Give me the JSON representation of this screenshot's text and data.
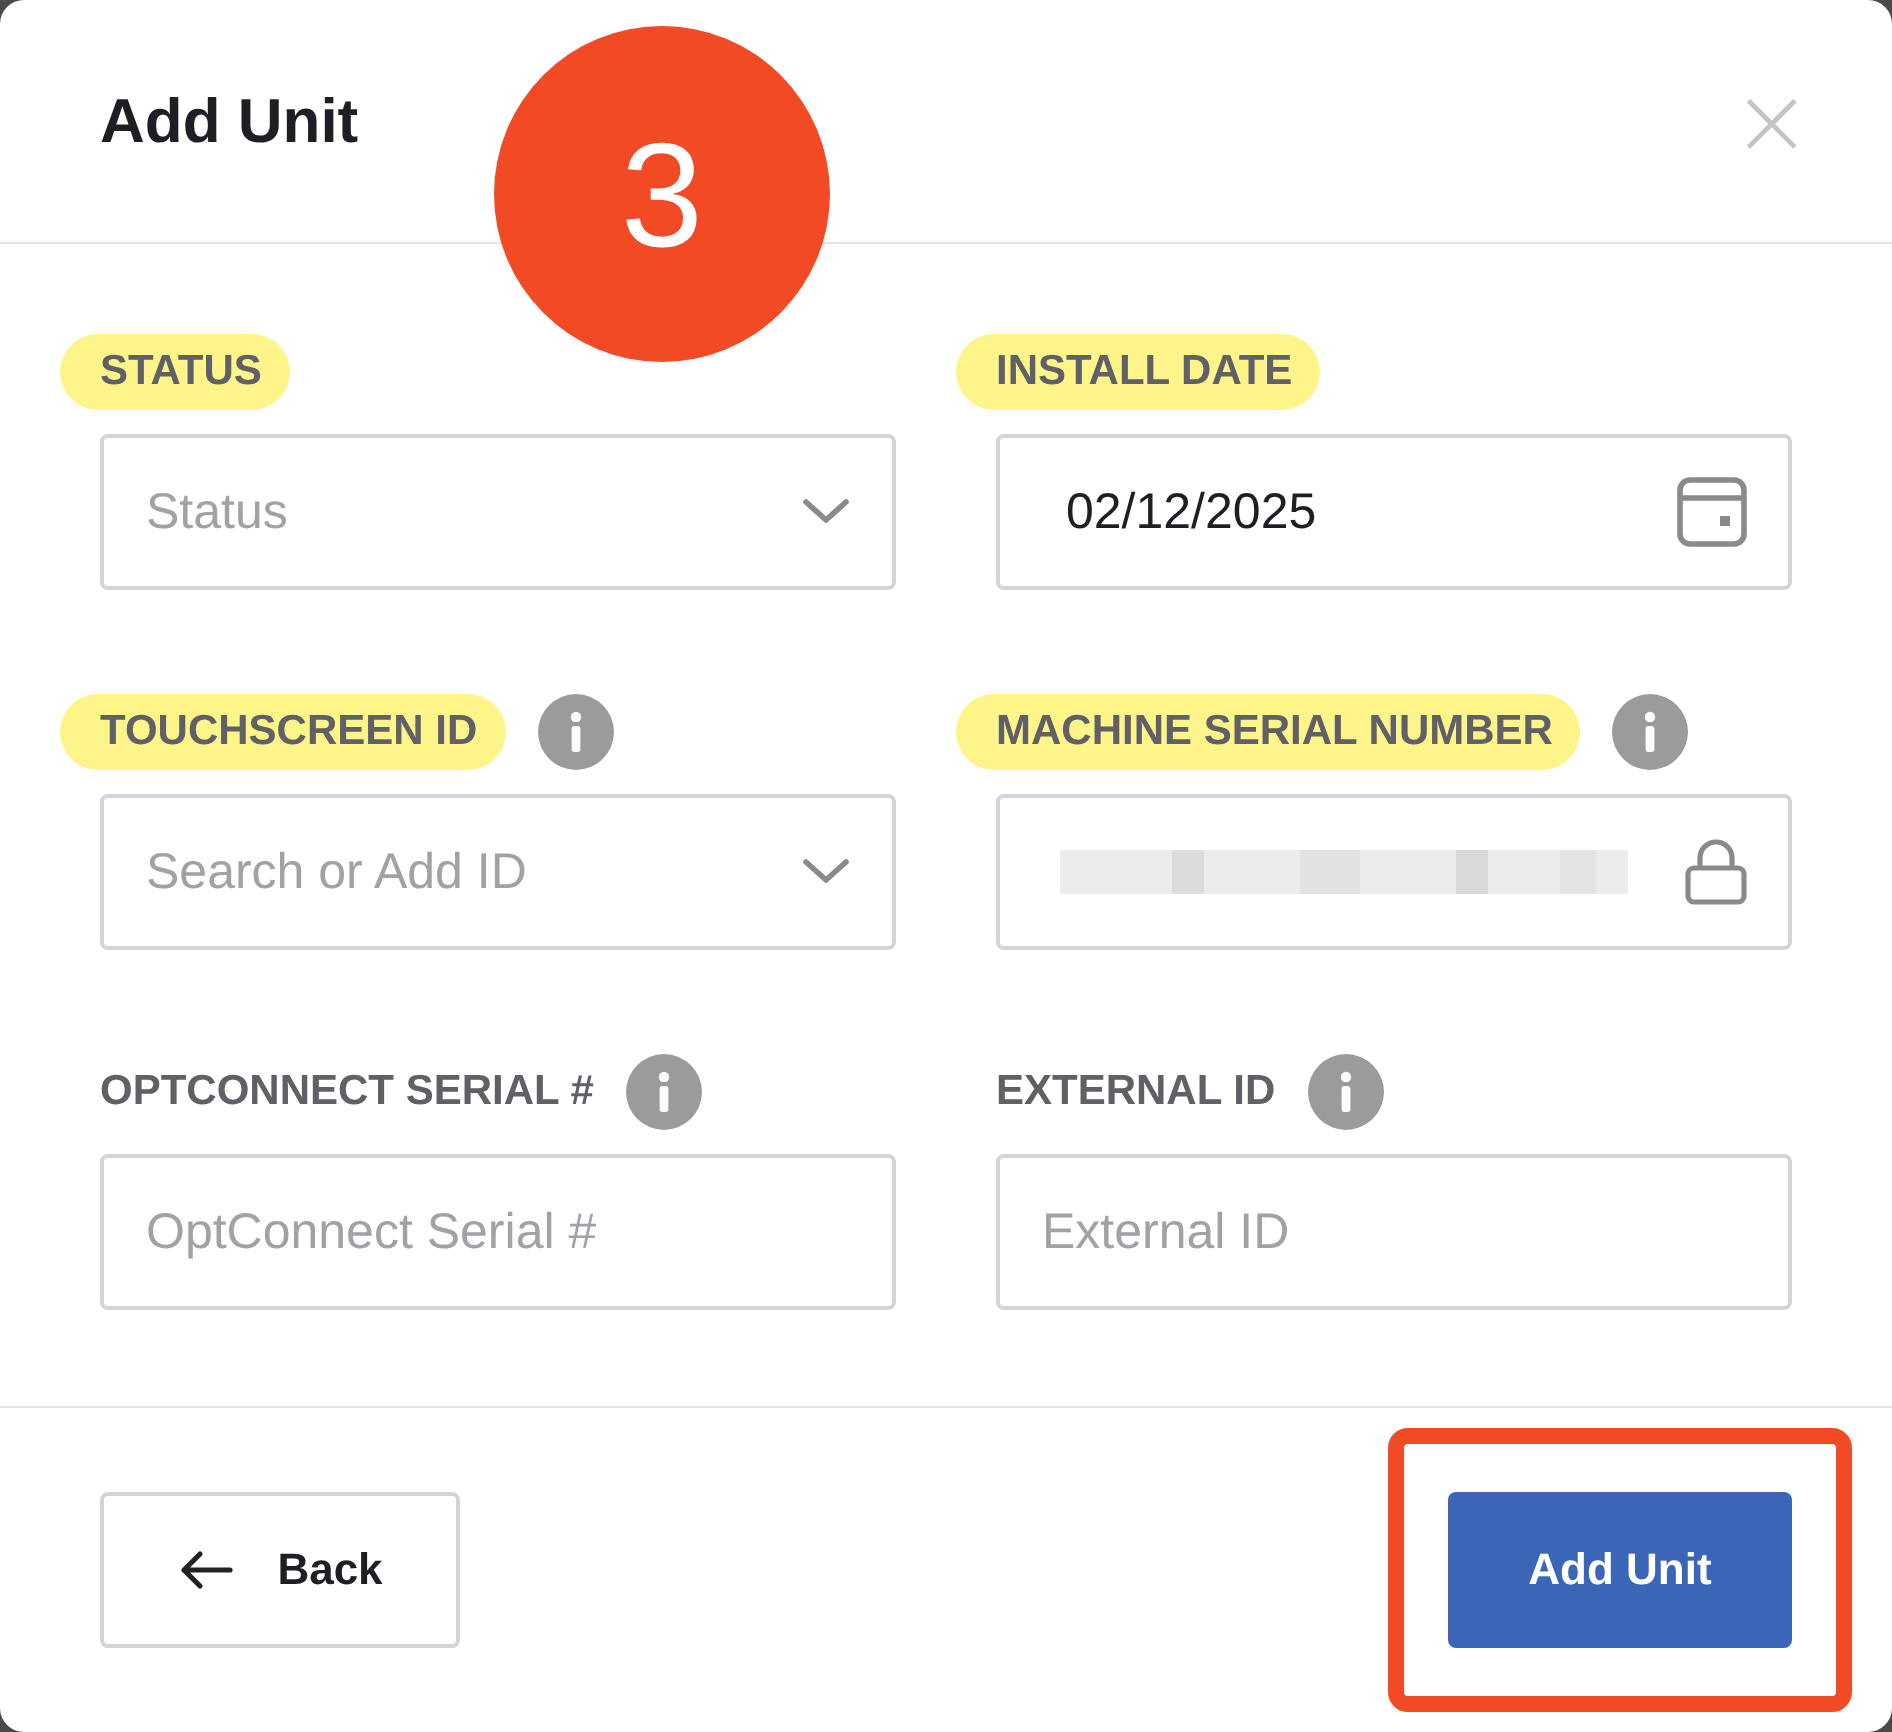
{
  "dialog": {
    "title": "Add Unit",
    "close": "×"
  },
  "step_badge": {
    "text": "3"
  },
  "fields": [
    {
      "label": "STATUS",
      "highlighted": true,
      "info": false,
      "kind": "select",
      "placeholder": "Status"
    },
    {
      "label": "INSTALL DATE",
      "highlighted": true,
      "info": false,
      "kind": "date",
      "value": "02/12/2025"
    },
    {
      "label": "TOUCHSCREEN ID",
      "highlighted": true,
      "info": true,
      "kind": "select",
      "placeholder": "Search or Add ID"
    },
    {
      "label": "MACHINE SERIAL NUMBER",
      "highlighted": true,
      "info": true,
      "kind": "locked",
      "redacted": true
    },
    {
      "label": "OPTCONNECT SERIAL #",
      "highlighted": false,
      "info": true,
      "kind": "text",
      "placeholder": "OptConnect Serial #"
    },
    {
      "label": "EXTERNAL ID",
      "highlighted": false,
      "info": true,
      "kind": "text",
      "placeholder": "External ID"
    }
  ],
  "footer": {
    "back_button": {
      "label": "Back"
    },
    "primary_button": {
      "label": "Add Unit",
      "outlined": true
    }
  }
}
